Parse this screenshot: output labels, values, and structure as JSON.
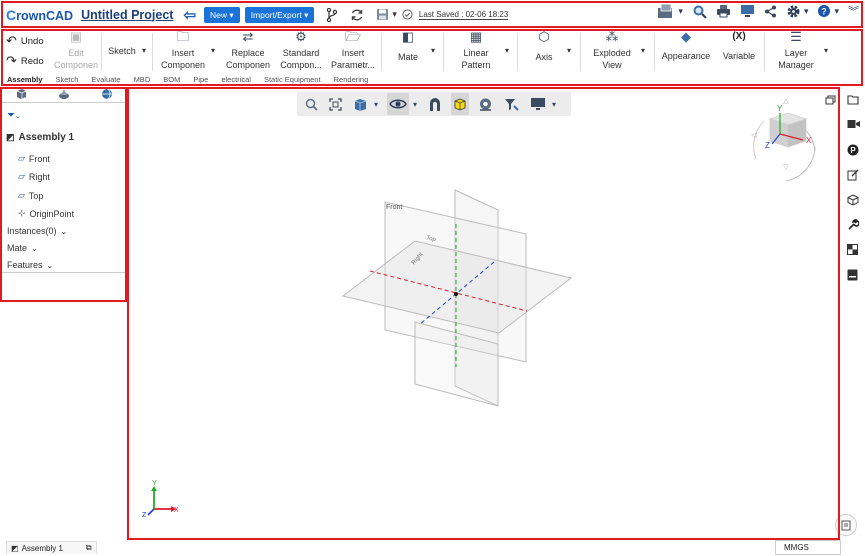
{
  "header": {
    "logo_c": "C",
    "logo_rest": "rownCAD",
    "project_title": "Untitled Project",
    "new_label": "New",
    "import_export_label": "Import/Export",
    "last_saved": "Last Saved : 02-06 18:23"
  },
  "toolbar": {
    "undo": "Undo",
    "redo": "Redo",
    "edit_component": [
      "Edit",
      "Componen"
    ],
    "sketch": "Sketch",
    "insert_component": [
      "Insert",
      "Componen"
    ],
    "replace_component": [
      "Replace",
      "Componen"
    ],
    "standard_component": [
      "Standard",
      "Compon..."
    ],
    "insert_parametric": [
      "Insert",
      "Parametr..."
    ],
    "mate": "Mate",
    "linear_pattern": [
      "Linear",
      "Pattern"
    ],
    "axis": "Axis",
    "exploded_view": [
      "Exploded",
      "View"
    ],
    "appearance": "Appearance",
    "variable": "Variable",
    "variable_icon": "(X)",
    "layer_manager": [
      "Layer",
      "Manager"
    ],
    "tabs": [
      "Assembly",
      "Sketch",
      "Evaluate",
      "MBD",
      "BOM",
      "Pipe",
      "electrical",
      "Static Equipment",
      "Rendering"
    ]
  },
  "tree": {
    "root": "Assembly 1",
    "items": [
      "Front",
      "Right",
      "Top",
      "OriginPoint"
    ],
    "instances": "Instances(0)",
    "mate": "Mate",
    "features": "Features"
  },
  "viewport": {
    "plane_front": "Front",
    "plane_top": "Top",
    "plane_right": "Right",
    "cube_axes": {
      "x": "X",
      "y": "Y",
      "z": "Z"
    },
    "triad_axes": {
      "x": "X",
      "y": "Y",
      "z": "Z"
    }
  },
  "status": {
    "doc_tab": "Assembly 1",
    "units": "MMGS"
  },
  "colors": {
    "accent": "#1a73d9",
    "highlight_box": "#e01b24",
    "axis_x": "#e01b24",
    "axis_y": "#22aa22",
    "axis_z": "#2244dd"
  },
  "icons": [
    "c-logo",
    "back-arrow-icon",
    "branch-icon",
    "sync-icon",
    "save-icon",
    "check-circle-icon",
    "display-icon",
    "search-icon",
    "print-icon",
    "monitor-icon",
    "share-icon",
    "gear-icon",
    "help-icon",
    "collapse-icon"
  ]
}
